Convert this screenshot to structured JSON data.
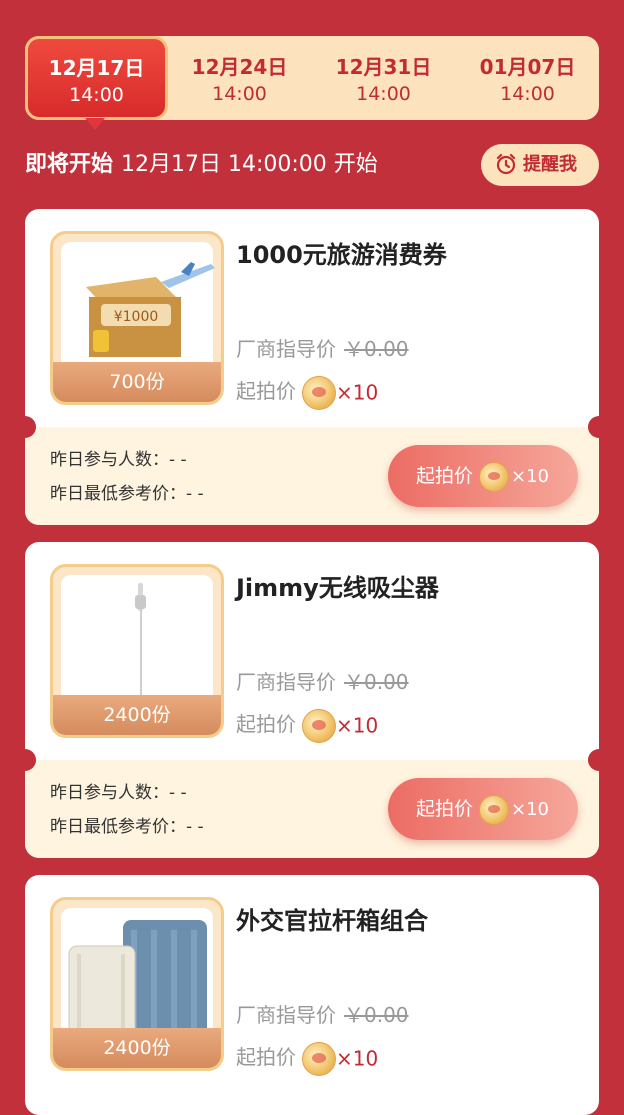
{
  "tabs": [
    {
      "date": "12月17日",
      "time": "14:00",
      "active": true
    },
    {
      "date": "12月24日",
      "time": "14:00",
      "active": false
    },
    {
      "date": "12月31日",
      "time": "14:00",
      "active": false
    },
    {
      "date": "01月07日",
      "time": "14:00",
      "active": false
    }
  ],
  "status": {
    "label": "即将开始",
    "time": "12月17日 14:00:00 开始"
  },
  "remind_label": "提醒我",
  "labels": {
    "guide": "厂商指导价",
    "start": "起拍价",
    "yesterday_people": "昨日参与人数：- -",
    "yesterday_lowest": "昨日最低参考价：- -",
    "bid_button": "起拍价",
    "multiplier": "×10"
  },
  "items": [
    {
      "title": "1000元旅游消费券",
      "qty": "700份",
      "guide_price": "￥0.00",
      "voucher_text": "¥1000"
    },
    {
      "title": "Jimmy无线吸尘器",
      "qty": "2400份",
      "guide_price": "￥0.00"
    },
    {
      "title": "外交官拉杆箱组合",
      "qty": "2400份",
      "guide_price": "￥0.00"
    }
  ],
  "colors": {
    "background": "#c1303b",
    "accent": "#c22b34",
    "tab_bg": "#fde3bd"
  }
}
